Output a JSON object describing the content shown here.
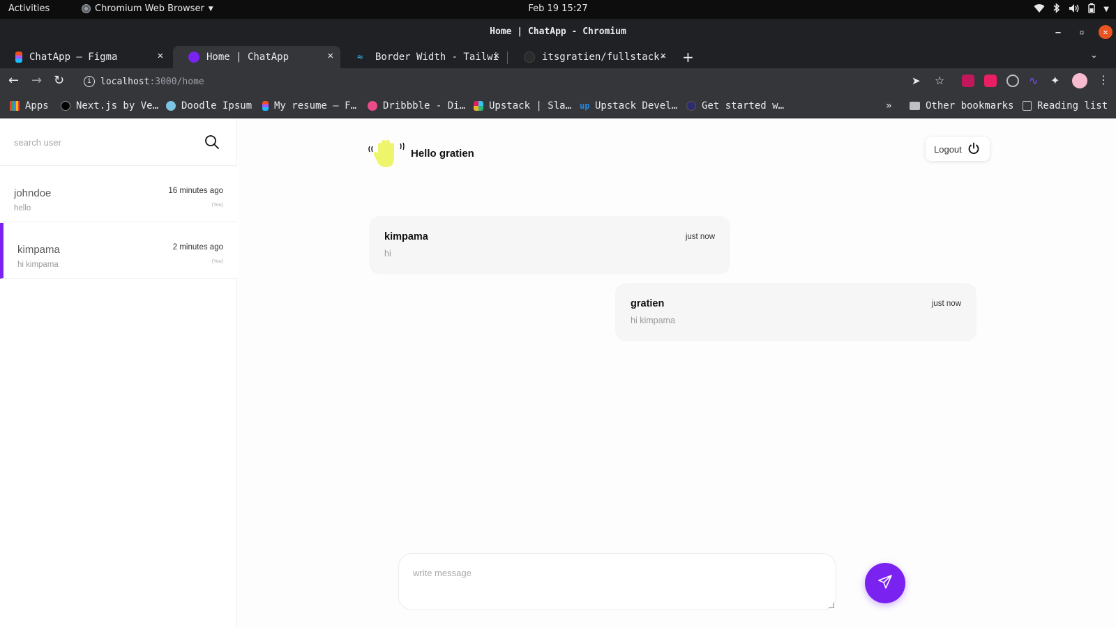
{
  "os": {
    "activities": "Activities",
    "app_name": "Chromium Web Browser",
    "clock": "Feb 19  15:27"
  },
  "window": {
    "title": "Home | ChatApp - Chromium"
  },
  "tabs": [
    {
      "label": "ChatApp – Figma",
      "active": false,
      "color": "#f24e1e"
    },
    {
      "label": "Home | ChatApp",
      "active": true,
      "color": "#7a22f0"
    },
    {
      "label": "Border Width - Tailwi",
      "active": false,
      "color": "#38bdf8"
    },
    {
      "label": "itsgratien/fullstack-c",
      "active": false,
      "color": "#24292e"
    }
  ],
  "toolbar": {
    "url_host": "localhost",
    "url_path": ":3000/home"
  },
  "bookmarks": {
    "items": [
      {
        "label": "Apps",
        "color": "#4285f4"
      },
      {
        "label": "Next.js by Ve…",
        "color": "#000000"
      },
      {
        "label": "Doodle Ipsum",
        "color": "#7dc4e4"
      },
      {
        "label": "My resume – F…",
        "color": "#f24e1e"
      },
      {
        "label": "Dribbble - Di…",
        "color": "#ea4c89"
      },
      {
        "label": "Upstack | Sla…",
        "color": "#e01e5a"
      },
      {
        "label": "Upstack Devel…",
        "color": "#1e88e5"
      },
      {
        "label": "Get started w…",
        "color": "#2d2d6e"
      }
    ],
    "other": "Other bookmarks",
    "reading": "Reading list"
  },
  "sidebar": {
    "search_placeholder": "search user",
    "contacts": [
      {
        "name": "johndoe",
        "preview": "hello",
        "time": "16 minutes ago",
        "tag": "(You)",
        "active": false
      },
      {
        "name": "kimpama",
        "preview": "hi kimpama",
        "time": "2 minutes ago",
        "tag": "(You)",
        "active": true
      }
    ]
  },
  "chat": {
    "greeting": "Hello  gratien",
    "logout_label": "Logout",
    "messages": [
      {
        "author": "kimpama",
        "text": "hi",
        "time": "just now",
        "side": "left"
      },
      {
        "author": "gratien",
        "text": "hi kimpama",
        "time": "just now",
        "side": "right"
      }
    ],
    "composer_placeholder": "write message"
  },
  "colors": {
    "accent": "#7a22f0",
    "hand": "#eef56a"
  }
}
